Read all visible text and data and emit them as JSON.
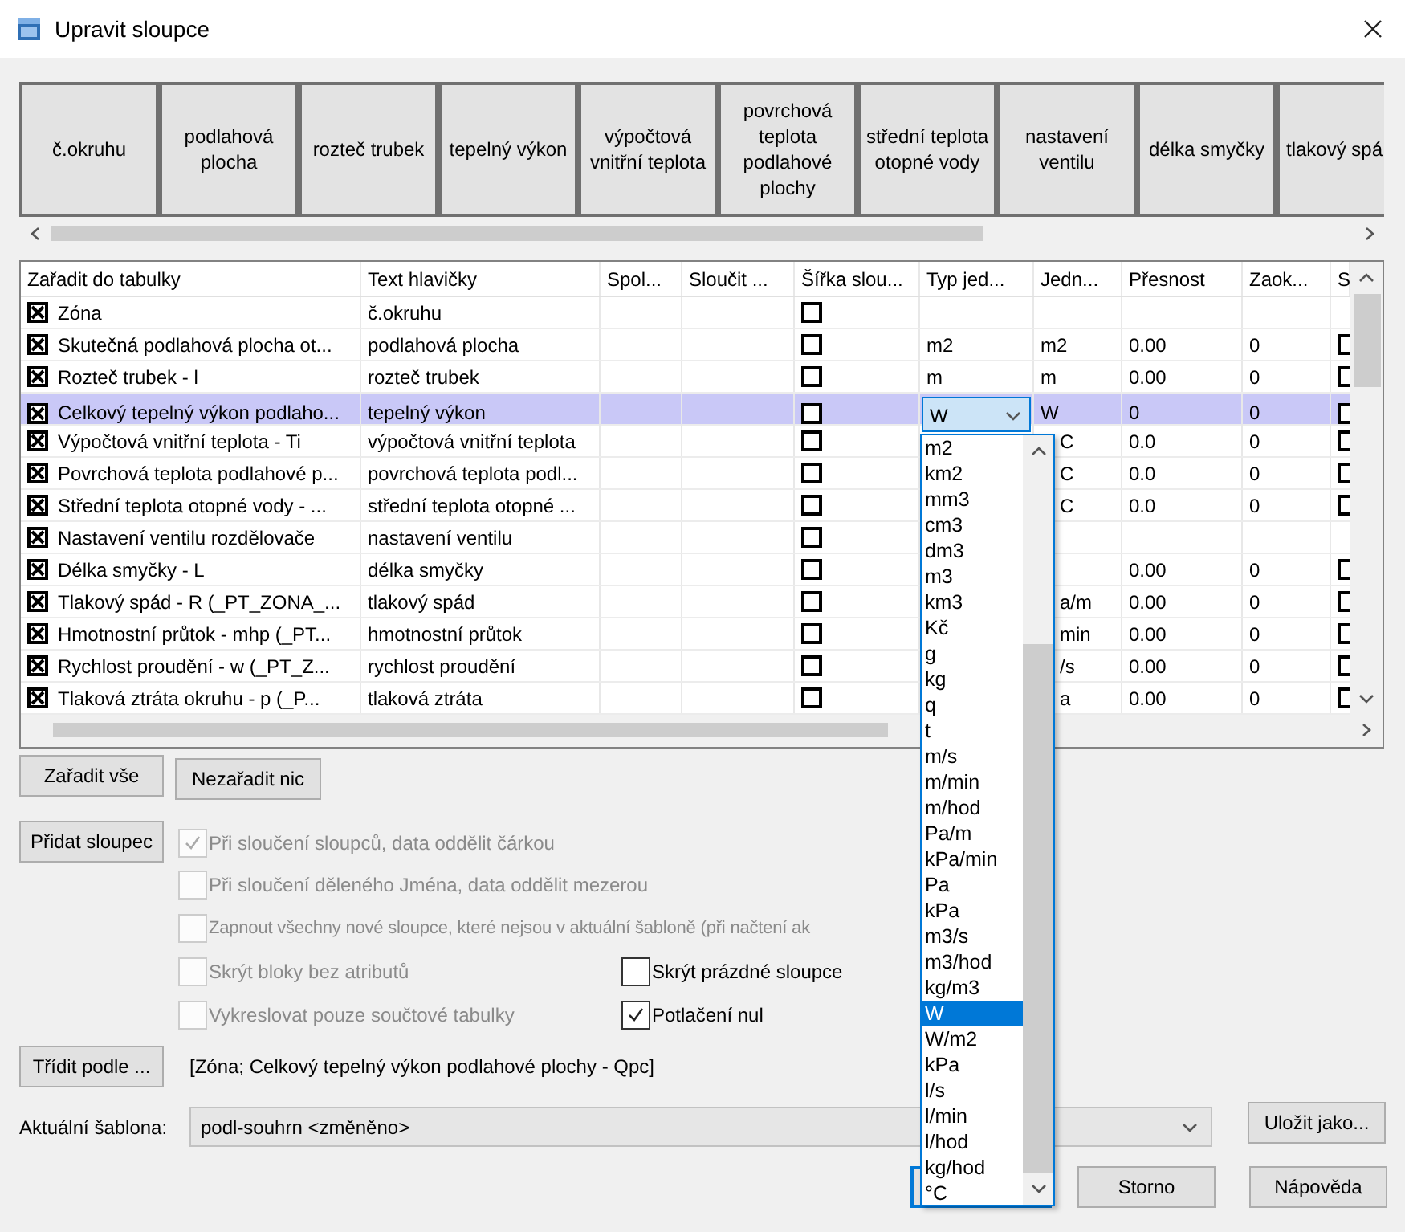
{
  "window": {
    "title": "Upravit sloupce"
  },
  "preview_headers": [
    "č.okruhu",
    "podlahová plocha",
    "rozteč trubek",
    "tepelný výkon",
    "výpočtová vnitřní teplota",
    "povrchová teplota podlahové plochy",
    "střední teplota otopné vody",
    "nastavení ventilu",
    "délka smyčky",
    "tlakový spá"
  ],
  "columns_table": {
    "columns": [
      "Zařadit do tabulky",
      "Text hlavičky",
      "Spol...",
      "Sloučit ...",
      "Šířka slou...",
      "Typ jed...",
      "Jedn...",
      "Přesnost",
      "Zaok...",
      "S"
    ],
    "rows": [
      {
        "included": true,
        "name": "Zóna",
        "header": "č.okruhu",
        "width_checked": false,
        "selected": false
      },
      {
        "included": true,
        "name": "Skutečná podlahová plocha ot...",
        "header": "podlahová plocha",
        "width_checked": false,
        "unit_type": "m2",
        "unit": "m2",
        "precision": "0.00",
        "rounding": "0",
        "s_checked": false,
        "selected": false
      },
      {
        "included": true,
        "name": "Rozteč trubek - l",
        "header": "rozteč trubek",
        "width_checked": false,
        "unit_type": "m",
        "unit": "m",
        "precision": "0.00",
        "rounding": "0",
        "s_checked": false,
        "selected": false
      },
      {
        "included": true,
        "name": "Celkový tepelný výkon podlaho...",
        "header": "tepelný výkon",
        "width_checked": false,
        "unit_type": "W",
        "unit": "W",
        "precision": "0",
        "rounding": "0",
        "s_checked": false,
        "selected": true
      },
      {
        "included": true,
        "name": "Výpočtová vnitřní teplota - Ti",
        "header": "výpočtová vnitřní teplota",
        "width_checked": false,
        "unit": "C",
        "precision": "0.0",
        "rounding": "0",
        "s_checked": false,
        "selected": false
      },
      {
        "included": true,
        "name": "Povrchová teplota podlahové p...",
        "header": "povrchová teplota podl...",
        "width_checked": false,
        "unit": "C",
        "precision": "0.0",
        "rounding": "0",
        "s_checked": false,
        "selected": false
      },
      {
        "included": true,
        "name": "Střední teplota otopné vody - ...",
        "header": "střední teplota otopné ...",
        "width_checked": false,
        "unit": "C",
        "precision": "0.0",
        "rounding": "0",
        "s_checked": false,
        "selected": false
      },
      {
        "included": true,
        "name": "Nastavení ventilu rozdělovače",
        "header": "nastavení ventilu",
        "width_checked": false,
        "selected": false
      },
      {
        "included": true,
        "name": "Délka smyčky - L",
        "header": "délka smyčky",
        "width_checked": false,
        "precision": "0.00",
        "rounding": "0",
        "s_checked": false,
        "selected": false
      },
      {
        "included": true,
        "name": "Tlakový spád - R (_PT_ZONA_...",
        "header": "tlakový spád",
        "width_checked": false,
        "unit": "a/m",
        "precision": "0.00",
        "rounding": "0",
        "s_checked": false,
        "selected": false
      },
      {
        "included": true,
        "name": "Hmotnostní průtok - mhp (_PT...",
        "header": "hmotnostní průtok",
        "width_checked": false,
        "unit": "min",
        "precision": "0.00",
        "rounding": "0",
        "s_checked": false,
        "selected": false
      },
      {
        "included": true,
        "name": "Rychlost proudění - w (_PT_Z...",
        "header": "rychlost proudění",
        "width_checked": false,
        "unit": "/s",
        "precision": "0.00",
        "rounding": "0",
        "s_checked": false,
        "selected": false
      },
      {
        "included": true,
        "name": "Tlaková ztráta okruhu - p (_P...",
        "header": "tlaková ztráta",
        "width_checked": false,
        "unit": "a",
        "precision": "0.00",
        "rounding": "0",
        "s_checked": false,
        "selected": false
      }
    ]
  },
  "unit_options": [
    {
      "label": "m2",
      "selected": false
    },
    {
      "label": "km2",
      "selected": false
    },
    {
      "label": "mm3",
      "selected": false
    },
    {
      "label": "cm3",
      "selected": false
    },
    {
      "label": "dm3",
      "selected": false
    },
    {
      "label": "m3",
      "selected": false
    },
    {
      "label": "km3",
      "selected": false
    },
    {
      "label": "Kč",
      "selected": false
    },
    {
      "label": "g",
      "selected": false
    },
    {
      "label": "kg",
      "selected": false
    },
    {
      "label": "q",
      "selected": false
    },
    {
      "label": "t",
      "selected": false
    },
    {
      "label": "m/s",
      "selected": false
    },
    {
      "label": "m/min",
      "selected": false
    },
    {
      "label": "m/hod",
      "selected": false
    },
    {
      "label": "Pa/m",
      "selected": false
    },
    {
      "label": "kPa/min",
      "selected": false
    },
    {
      "label": "Pa",
      "selected": false
    },
    {
      "label": "kPa",
      "selected": false
    },
    {
      "label": "m3/s",
      "selected": false
    },
    {
      "label": "m3/hod",
      "selected": false
    },
    {
      "label": "kg/m3",
      "selected": false
    },
    {
      "label": "W",
      "selected": true
    },
    {
      "label": "W/m2",
      "selected": false
    },
    {
      "label": "kPa",
      "selected": false
    },
    {
      "label": "l/s",
      "selected": false
    },
    {
      "label": "l/min",
      "selected": false
    },
    {
      "label": "l/hod",
      "selected": false
    },
    {
      "label": "kg/hod",
      "selected": false
    },
    {
      "label": "°C",
      "selected": false
    }
  ],
  "table_buttons": [
    "Zařadit vše",
    "Nezařadit nic"
  ],
  "add_column_button": "Přidat sloupec",
  "options": [
    {
      "label": "Při sloučení sloupců, data oddělit čárkou",
      "checked": true,
      "disabled": true
    },
    {
      "label": "Při sloučení děleného Jména, data oddělit mezerou",
      "checked": false,
      "disabled": true
    },
    {
      "label": "Zapnout všechny nové sloupce, které nejsou v aktuální šabloně (při načtení ak",
      "checked": false,
      "disabled": true
    },
    {
      "label": "Skrýt bloky bez atributů",
      "checked": false,
      "disabled": true
    },
    {
      "label": "Vykreslovat pouze součtové tabulky",
      "checked": false,
      "disabled": true
    }
  ],
  "options_right": [
    {
      "label": "Skrýt prázdné sloupce",
      "checked": false,
      "disabled": false
    },
    {
      "label": "Potlačení nul",
      "checked": true,
      "disabled": false
    }
  ],
  "sort_button": "Třídit podle ...",
  "sort_order": "[Zóna; Celkový tepelný výkon podlahové plochy - Qpc]",
  "template": {
    "label": "Aktuální šablona:",
    "value": "podl-souhrn <změněno>"
  },
  "save_as_button": "Uložit jako...",
  "footer_buttons": [
    "Storno",
    "Nápověda"
  ]
}
